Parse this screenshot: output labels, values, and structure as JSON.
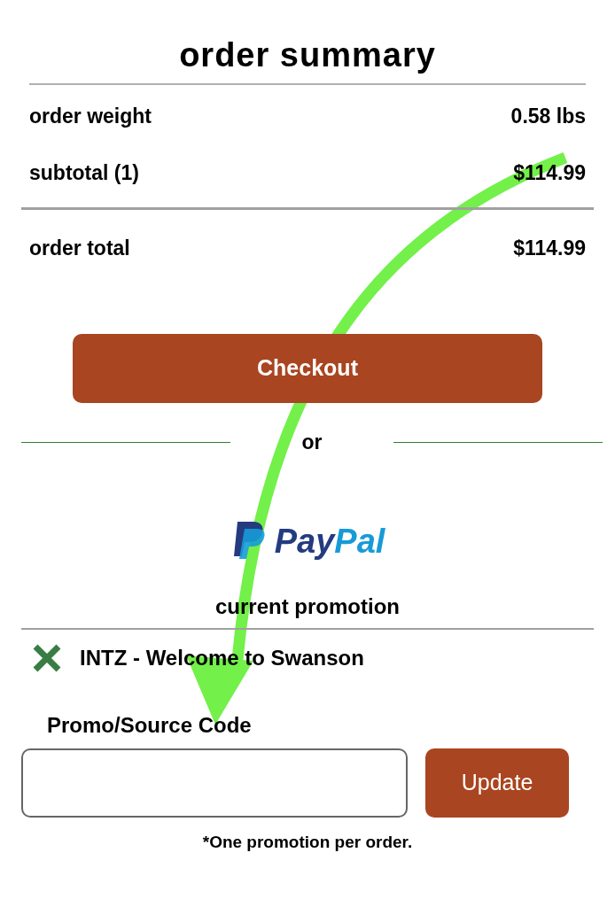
{
  "title": "order summary",
  "summary_rows": [
    {
      "label": "order weight",
      "value": "0.58 lbs"
    },
    {
      "label": "subtotal (1)",
      "value": "$114.99"
    }
  ],
  "total": {
    "label": "order total",
    "value": "$114.99"
  },
  "checkout_button": "Checkout",
  "divider_text": "or",
  "paypal_button": {
    "label_dark": "Pay",
    "label_light": "Pal"
  },
  "promotion": {
    "heading": "current promotion",
    "applied": "INTZ - Welcome to Swanson"
  },
  "promo_field": {
    "label": "Promo/Source Code"
  },
  "update_button": "Update",
  "note": "*One promotion per order."
}
